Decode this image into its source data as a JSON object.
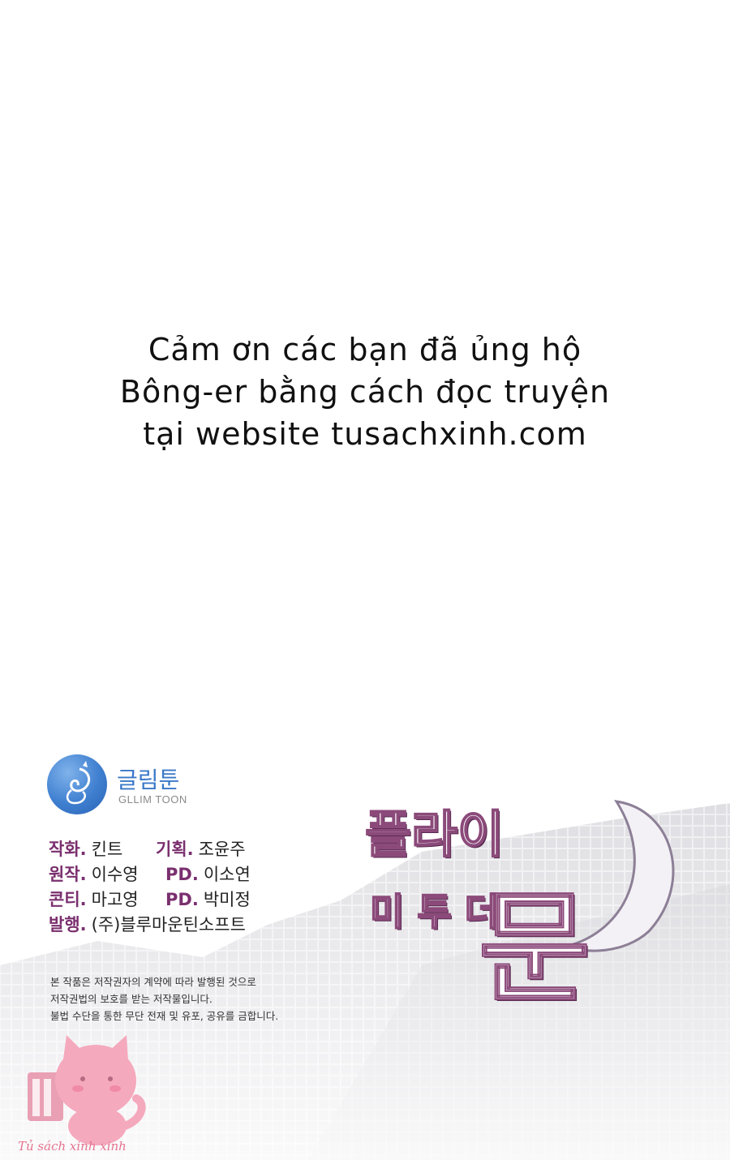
{
  "thanks_message": {
    "line1": "Cảm ơn các bạn đã ủng hộ",
    "line2": "Bông-er bằng cách đọc truyện",
    "line3": "tại website tusachxinh.com"
  },
  "publisher_logo": {
    "name_kr": "글림툰",
    "name_en": "GLLIM TOON",
    "icon": "cat-swirl-icon"
  },
  "credits": [
    {
      "label": "작화.",
      "value": "킨트",
      "label2": "기획.",
      "value2": "조윤주"
    },
    {
      "label": "원작.",
      "value": "이수영",
      "label2": "PD.",
      "value2": "이소연"
    },
    {
      "label": "콘티.",
      "value": "마고영",
      "label2": "PD.",
      "value2": "박미정"
    },
    {
      "label": "발행.",
      "value": "(주)블루마운틴소프트",
      "label2": "",
      "value2": ""
    }
  ],
  "notice": {
    "line1": "본 작품은 저작권자의 계약에 따라 발행된 것으로",
    "line2": "저작권법의 보호를 받는 저작물입니다.",
    "line3": "불법 수단을 통한 무단 전재 및 유포, 공유를 금합니다."
  },
  "title_logo": {
    "part1": "플라이",
    "part2": "미 투 더",
    "part3": "문"
  },
  "watermark": {
    "text": "Tủ sách xinh xinh",
    "icon": "pink-cat-icon"
  },
  "colors": {
    "credit_label": "#7a2f6e",
    "logo_blue": "#3a78c8",
    "watermark_pink": "#e6738e"
  }
}
